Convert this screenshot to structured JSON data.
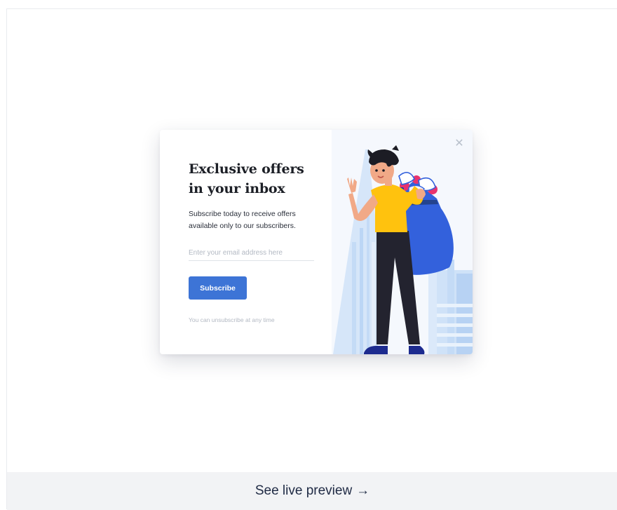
{
  "popup": {
    "title_line1": "Exclusive offers",
    "title_line2": "in your inbox",
    "description": "Subscribe today to receive offers available only to our subscribers.",
    "email_placeholder": "Enter your email address here",
    "email_value": "",
    "subscribe_label": "Subscribe",
    "note": "You can unsubscribe at any time",
    "close_icon": "close-icon",
    "colors": {
      "accent": "#3d74d6",
      "title": "#1c1f26",
      "muted": "#b3b9c3",
      "illustration_bg": "#f5f8fd",
      "building": "#cfe2f8",
      "shirt": "#ffc20e",
      "bag": "#3361dc"
    }
  },
  "footer": {
    "preview_label": "See live preview",
    "arrow": "→"
  }
}
